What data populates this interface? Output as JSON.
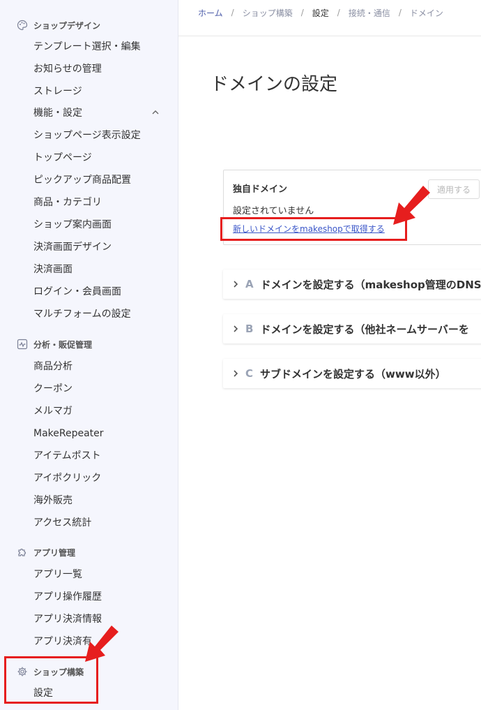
{
  "sidebar": {
    "sections": [
      {
        "title": "ショップデザイン",
        "icon": "palette-icon"
      },
      {
        "title": "分析・販促管理",
        "icon": "chart-icon"
      },
      {
        "title": "アプリ管理",
        "icon": "puzzle-icon"
      },
      {
        "title": "ショップ構築",
        "icon": "gear-icon"
      }
    ],
    "design_items": [
      "テンプレート選択・編集",
      "お知らせの管理",
      "ストレージ",
      "機能・設定",
      "ショップページ表示設定",
      "トップページ",
      "ピックアップ商品配置",
      "商品・カテゴリ",
      "ショップ案内画面",
      "決済画面デザイン",
      "決済画面",
      "ログイン・会員画面",
      "マルチフォームの設定"
    ],
    "analysis_items": [
      "商品分析",
      "クーポン",
      "メルマガ",
      "MakeRepeater",
      "アイテムポスト",
      "アイポクリック",
      "海外販売",
      "アクセス統計"
    ],
    "app_items": [
      "アプリ一覧",
      "アプリ操作履歴",
      "アプリ決済情報",
      "アプリ決済有"
    ],
    "build_items": [
      "設定"
    ]
  },
  "breadcrumb": [
    "ホーム",
    "ショップ構築",
    "設定",
    "接続・通信",
    "ドメイン"
  ],
  "page_title": "ドメインの設定",
  "card": {
    "title": "独自ドメイン",
    "status": "設定されていません",
    "link": "新しいドメインをmakeshopで取得する",
    "apply_button": "適用する"
  },
  "accordions": [
    {
      "letter": "A",
      "label": "ドメインを設定する（makeshop管理のDNS"
    },
    {
      "letter": "B",
      "label": "ドメインを設定する（他社ネームサーバーを"
    },
    {
      "letter": "C",
      "label": "サブドメインを設定する（www以外）"
    }
  ],
  "colors": {
    "highlight": "#e61e1e",
    "link": "#3a55c8",
    "sidebar_bg": "#f5f6fd"
  }
}
